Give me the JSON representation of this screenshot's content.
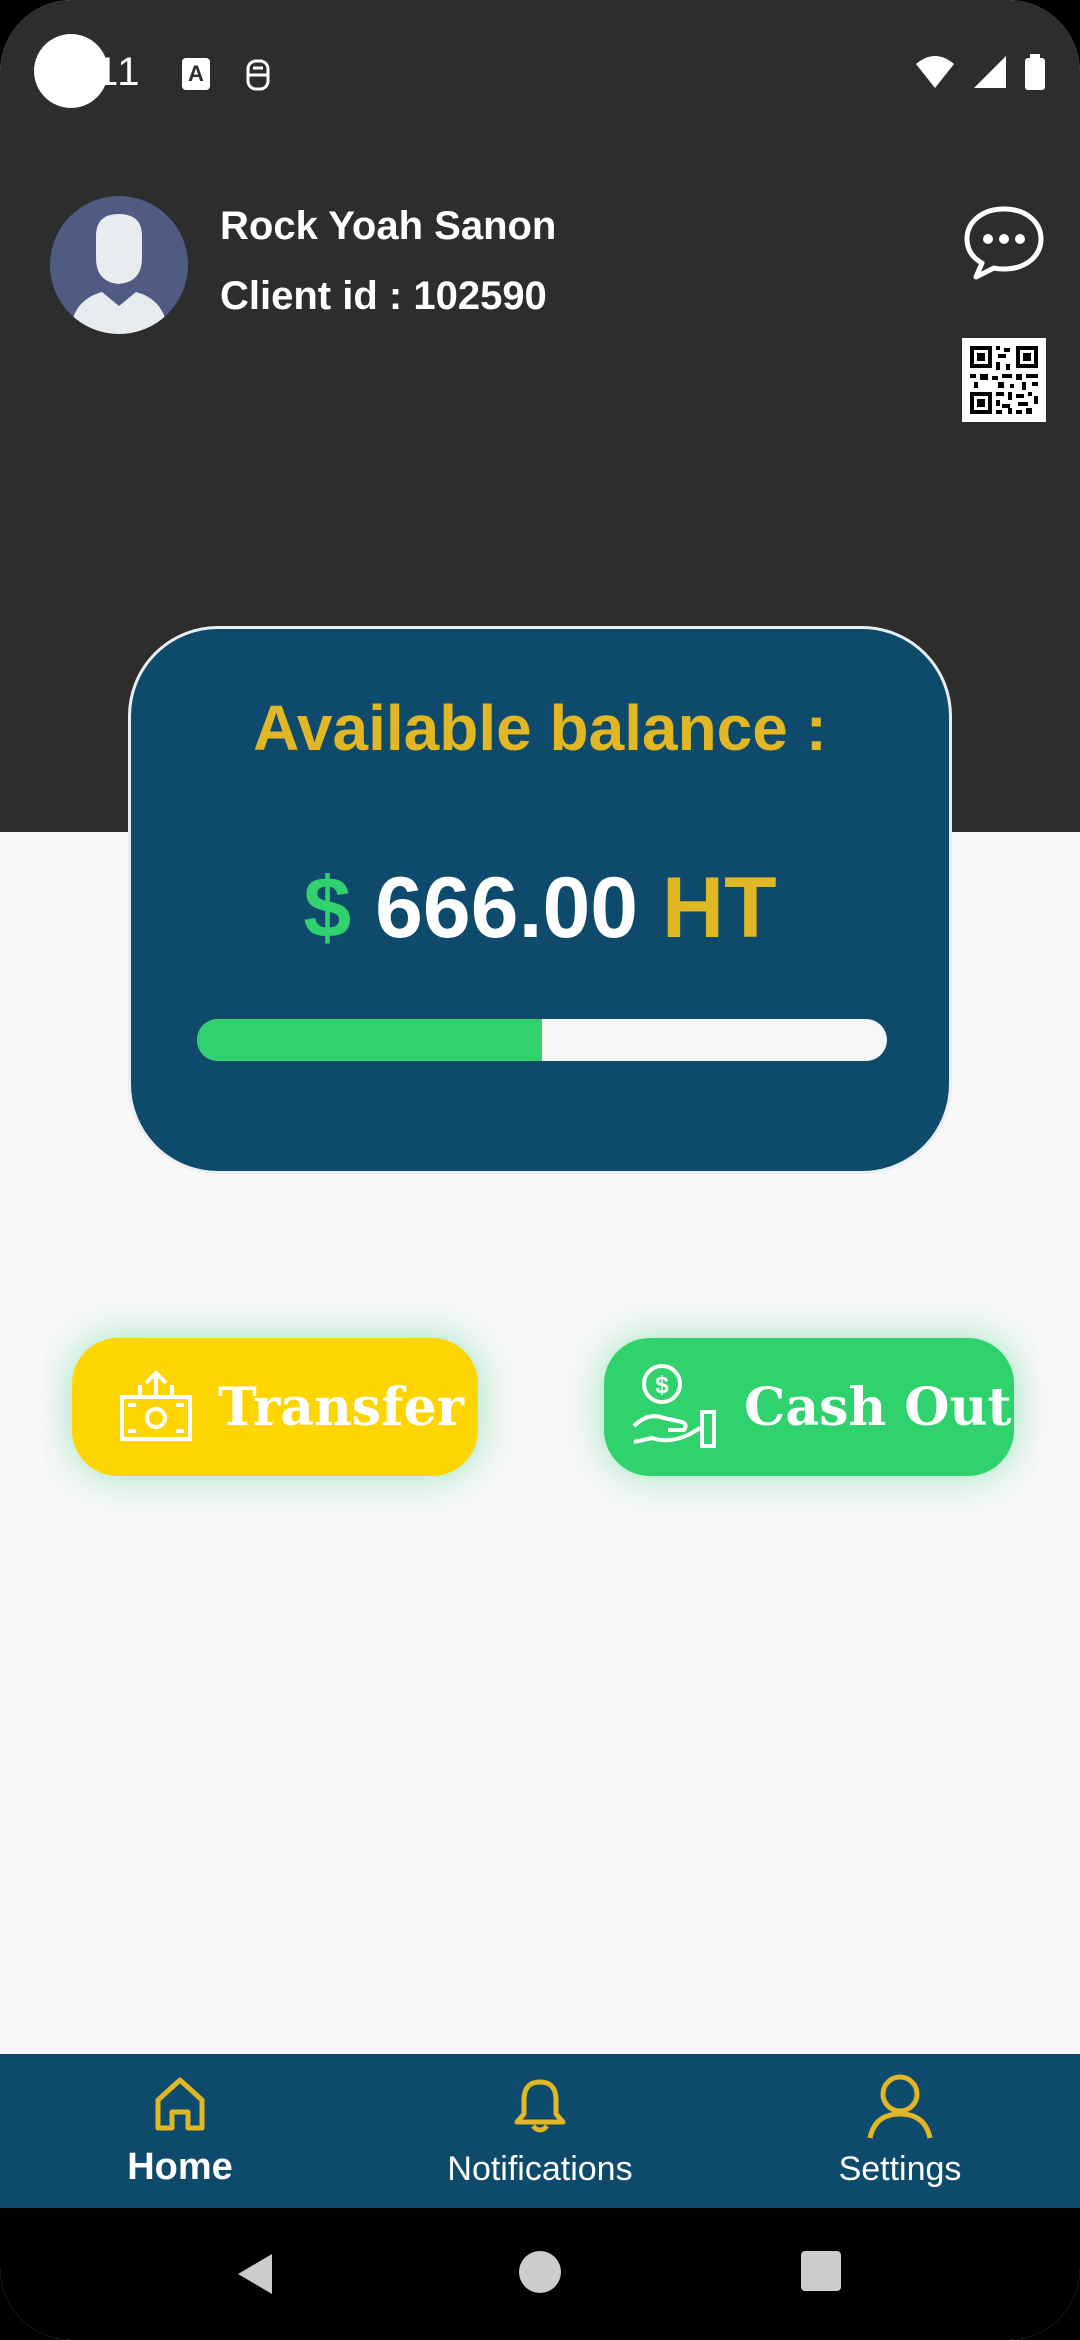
{
  "status_bar": {
    "time": "11",
    "icons": [
      "keyboard-a-icon",
      "sim-icon",
      "wifi-icon",
      "signal-icon",
      "battery-icon"
    ]
  },
  "profile": {
    "name": "Rock Yoah Sanon",
    "client_id_label": "Client id : ",
    "client_id_value": "102590"
  },
  "header_actions": [
    "chat-bubble-icon",
    "qr-code-icon"
  ],
  "balance": {
    "title": "Available balance :",
    "currency_symbol": "$",
    "amount": "666.00",
    "currency_code": "HT",
    "progress_fraction": 0.5
  },
  "actions": {
    "transfer_label": "Transfer",
    "cashout_label": "Cash Out"
  },
  "nav": {
    "home_label": "Home",
    "notifications_label": "Notifications",
    "settings_label": "Settings"
  },
  "colors": {
    "header_bg": "#2d2d2d",
    "card_bg": "#0d4a6b",
    "accent_yellow": "#e2b725",
    "accent_green": "#2fd26c",
    "transfer_bg": "#ffd500"
  }
}
